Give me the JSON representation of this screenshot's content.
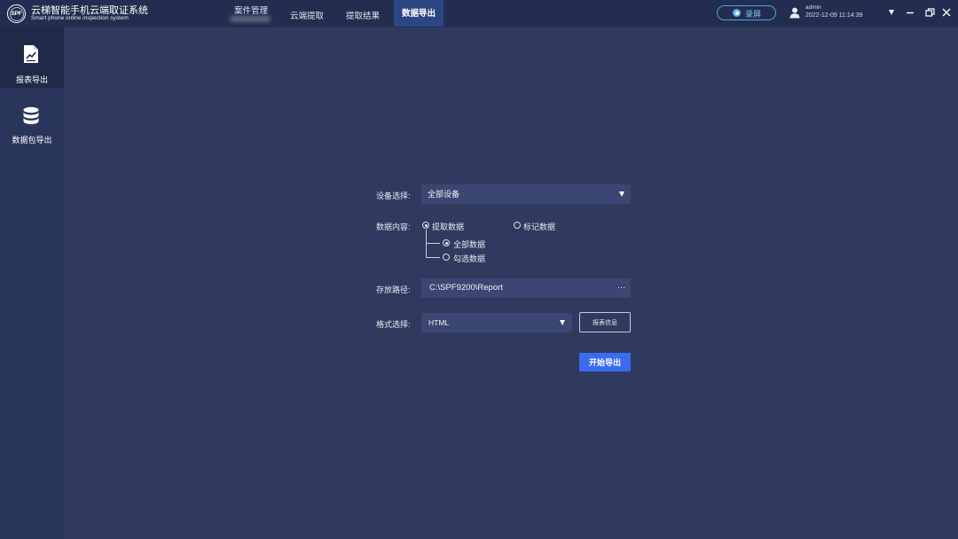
{
  "app": {
    "title": "云梯智能手机云端取证系统",
    "subtitle": "Smart phone online inspection system",
    "logo_text": "SPF"
  },
  "nav": {
    "tabs": [
      {
        "label": "案件管理",
        "active": false
      },
      {
        "label": "云端提取",
        "active": false
      },
      {
        "label": "提取结果",
        "active": false
      },
      {
        "label": "数据导出",
        "active": true
      }
    ]
  },
  "header": {
    "record_label": "录屏",
    "record_icon": "record-icon",
    "user_icon": "user-icon",
    "user": "admin",
    "datetime": "2022-12-09 11:14:39"
  },
  "window_controls": {
    "icons": [
      "chevron-down-icon",
      "minimize-icon",
      "restore-icon",
      "close-icon"
    ]
  },
  "sidebar": {
    "items": [
      {
        "label": "报表导出",
        "icon": "report-export-icon",
        "active": true
      },
      {
        "label": "数据包导出",
        "icon": "database-icon",
        "active": false
      }
    ]
  },
  "form": {
    "device": {
      "label": "设备选择:",
      "value": "全部设备"
    },
    "content": {
      "label": "数据内容:",
      "options": [
        {
          "label": "提取数据",
          "checked": true
        },
        {
          "label": "标记数据",
          "checked": false
        }
      ],
      "sub_options": [
        {
          "label": "全部数据",
          "checked": true
        },
        {
          "label": "勾选数据",
          "checked": false
        }
      ]
    },
    "path": {
      "label": "存放路径:",
      "value": "C:\\SPF9200\\Report",
      "browse_label": "···"
    },
    "format": {
      "label": "格式选择:",
      "value": "HTML",
      "info_button": "报表信息"
    },
    "start_button": "开始导出"
  },
  "colors": {
    "bg_main": "#2f3a5e",
    "bg_header": "#222d4f",
    "bg_sidebar": "#29355a",
    "bg_sidebar_active": "#1f2a49",
    "bg_field": "#3b4772",
    "accent": "#3a6cf0",
    "tab_active": "#2b4682",
    "record": "#4aa8e0"
  }
}
